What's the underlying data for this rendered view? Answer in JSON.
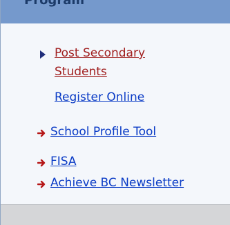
{
  "header": {
    "title": "Program"
  },
  "links": {
    "post_secondary_line1": "Post Secondary",
    "post_secondary_line2": "Students",
    "register_online": "Register Online",
    "school_profile_tool": "School Profile Tool",
    "fisa": "FISA",
    "achieve_bc_newsletter": "Achieve BC Newsletter"
  },
  "colors": {
    "header_bg": "#7599cc",
    "panel_bg": "#f4f7fb",
    "link": "#0b3cc6",
    "visited_link": "#a12020",
    "arrow": "#b61818",
    "footer": "#d5d6d8"
  },
  "icons": {
    "section_bullet": "triangle-right-icon",
    "link_arrow": "red-arrow-right-icon"
  }
}
